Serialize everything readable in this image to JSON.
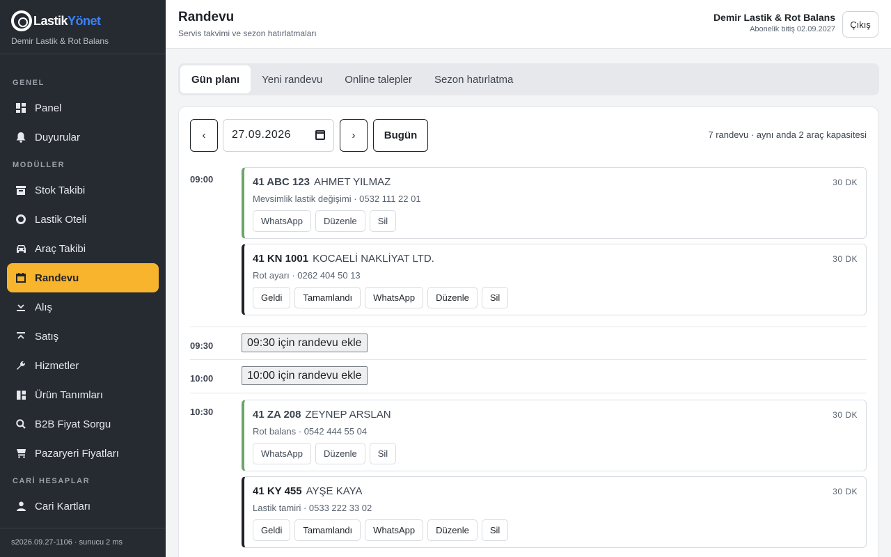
{
  "brand": {
    "logo_a": "Lastik",
    "logo_b": "Yönet",
    "subtitle": "Demir Lastik & Rot Balans"
  },
  "sidebar": {
    "sections": [
      {
        "title": "GENEL",
        "items": [
          {
            "label": "Panel",
            "icon": "grid-icon"
          },
          {
            "label": "Duyurular",
            "icon": "bell-icon"
          }
        ]
      },
      {
        "title": "MODÜLLER",
        "items": [
          {
            "label": "Stok Takibi",
            "icon": "warehouse-icon"
          },
          {
            "label": "Lastik Oteli",
            "icon": "tire-icon"
          },
          {
            "label": "Araç Takibi",
            "icon": "car-icon"
          },
          {
            "label": "Randevu",
            "icon": "calendar-icon",
            "active": true
          },
          {
            "label": "Alış",
            "icon": "download-icon"
          },
          {
            "label": "Satış",
            "icon": "upload-icon"
          },
          {
            "label": "Hizmetler",
            "icon": "wrench-icon"
          },
          {
            "label": "Ürün Tanımları",
            "icon": "dashboard-icon"
          },
          {
            "label": "B2B Fiyat Sorgu",
            "icon": "search-icon"
          },
          {
            "label": "Pazaryeri Fiyatları",
            "icon": "store-icon"
          }
        ]
      },
      {
        "title": "CARİ HESAPLAR",
        "items": [
          {
            "label": "Cari Kartları",
            "icon": "person-icon"
          }
        ]
      }
    ],
    "footer": "s2026.09.27-1106 · sunucu 2 ms"
  },
  "header": {
    "title": "Randevu",
    "subtitle": "Servis takvimi ve sezon hatırlatmaları",
    "company": "Demir Lastik & Rot Balans",
    "subscription": "Abonelik bitiş 02.09.2027",
    "logout": "Çıkış"
  },
  "tabs": [
    "Gün planı",
    "Yeni randevu",
    "Online talepler",
    "Sezon hatırlatma"
  ],
  "toolbar": {
    "prev": "‹",
    "date": "27.09.2026",
    "next": "›",
    "today": "Bugün",
    "summary": "7 randevu · aynı anda 2 araç kapasitesi"
  },
  "schedule": {
    "slot_0900": "09:00",
    "slot_0930": "09:30",
    "slot_1000": "10:00",
    "slot_1030": "10:30",
    "add_0930": "09:30 için randevu ekle",
    "add_1000": "10:00 için randevu ekle",
    "appointments": [
      {
        "plate": "41 ABC 123",
        "customer": "AHMET YILMAZ",
        "detail": "Mevsimlik lastik değişimi · 0532 111 22 01",
        "duration": "30 DK",
        "actions": [
          "WhatsApp",
          "Düzenle",
          "Sil"
        ]
      },
      {
        "plate": "41 KN 1001",
        "customer": "KOCAELİ NAKLİYAT LTD.",
        "detail": "Rot ayarı · 0262 404 50 13",
        "duration": "30 DK",
        "actions": [
          "Geldi",
          "Tamamlandı",
          "WhatsApp",
          "Düzenle",
          "Sil"
        ]
      },
      {
        "plate": "41 ZA 208",
        "customer": "ZEYNEP ARSLAN",
        "detail": "Rot balans · 0542 444 55 04",
        "duration": "30 DK",
        "actions": [
          "WhatsApp",
          "Düzenle",
          "Sil"
        ]
      },
      {
        "plate": "41 KY 455",
        "customer": "AYŞE KAYA",
        "detail": "Lastik tamiri · 0533 222 33 02",
        "duration": "30 DK",
        "actions": [
          "Geldi",
          "Tamamlandı",
          "WhatsApp",
          "Düzenle",
          "Sil"
        ]
      }
    ]
  }
}
